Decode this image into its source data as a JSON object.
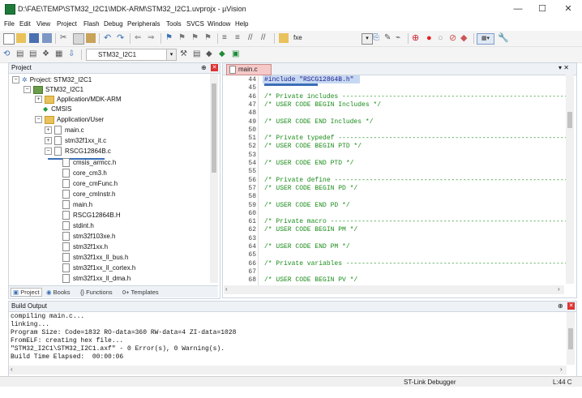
{
  "window": {
    "title": "D:\\FAE\\TEMP\\STM32_I2C1\\MDK-ARM\\STM32_I2C1.uvprojx - µVision",
    "minimize": "—",
    "maximize": "☐",
    "close": "✕"
  },
  "menu": [
    "File",
    "Edit",
    "View",
    "Project",
    "Flash",
    "Debug",
    "Peripherals",
    "Tools",
    "SVCS",
    "Window",
    "Help"
  ],
  "toolbar": {
    "find_text": "fxe",
    "target_name": "STM32_I2C1"
  },
  "project_panel": {
    "title": "Project",
    "pin": "⊕",
    "close": "✕",
    "root": "Project: STM32_I2C1",
    "target": "STM32_I2C1",
    "groups": [
      {
        "name": "Application/MDK-ARM"
      },
      {
        "name": "CMSIS"
      },
      {
        "name": "Application/User"
      }
    ],
    "user_files": [
      "main.c",
      "stm32f1xx_it.c",
      "RSCG12864B.c"
    ],
    "headers": [
      "cmsis_armcc.h",
      "core_cm3.h",
      "core_cmFunc.h",
      "core_cmInstr.h",
      "main.h",
      "RSCG12864B.H",
      "stdint.h",
      "stm32f103xe.h",
      "stm32f1xx.h",
      "stm32f1xx_ll_bus.h",
      "stm32f1xx_ll_cortex.h",
      "stm32f1xx_ll_dma.h"
    ],
    "tabs": [
      "Project",
      "Books",
      "{} Functions",
      "0+ Templates"
    ]
  },
  "editor": {
    "tab": "main.c",
    "close_all": "▾ ✕",
    "lines": [
      {
        "n": "44",
        "text": "#include \"RSCG12864B.h\"",
        "kind": "dir"
      },
      {
        "n": "45",
        "text": "",
        "kind": "cmt"
      },
      {
        "n": "46",
        "text": "/* Private includes ----------------------------------------------------------",
        "kind": "cmt"
      },
      {
        "n": "47",
        "text": "/* USER CODE BEGIN Includes */",
        "kind": "cmt"
      },
      {
        "n": "48",
        "text": "",
        "kind": "cmt"
      },
      {
        "n": "49",
        "text": "/* USER CODE END Includes */",
        "kind": "cmt"
      },
      {
        "n": "50",
        "text": "",
        "kind": "cmt"
      },
      {
        "n": "51",
        "text": "/* Private typedef -----------------------------------------------------------",
        "kind": "cmt"
      },
      {
        "n": "52",
        "text": "/* USER CODE BEGIN PTD */",
        "kind": "cmt"
      },
      {
        "n": "53",
        "text": "",
        "kind": "cmt"
      },
      {
        "n": "54",
        "text": "/* USER CODE END PTD */",
        "kind": "cmt"
      },
      {
        "n": "55",
        "text": "",
        "kind": "cmt"
      },
      {
        "n": "56",
        "text": "/* Private define ------------------------------------------------------------",
        "kind": "cmt"
      },
      {
        "n": "57",
        "text": "/* USER CODE BEGIN PD */",
        "kind": "cmt"
      },
      {
        "n": "58",
        "text": "",
        "kind": "cmt"
      },
      {
        "n": "59",
        "text": "/* USER CODE END PD */",
        "kind": "cmt"
      },
      {
        "n": "60",
        "text": "",
        "kind": "cmt"
      },
      {
        "n": "61",
        "text": "/* Private macro -------------------------------------------------------------",
        "kind": "cmt"
      },
      {
        "n": "62",
        "text": "/* USER CODE BEGIN PM */",
        "kind": "cmt"
      },
      {
        "n": "63",
        "text": "",
        "kind": "cmt"
      },
      {
        "n": "64",
        "text": "/* USER CODE END PM */",
        "kind": "cmt"
      },
      {
        "n": "65",
        "text": "",
        "kind": "cmt"
      },
      {
        "n": "66",
        "text": "/* Private variables ---------------------------------------------------------",
        "kind": "cmt"
      },
      {
        "n": "67",
        "text": "",
        "kind": "cmt"
      },
      {
        "n": "68",
        "text": "/* USER CODE BEGIN PV */",
        "kind": "cmt"
      }
    ]
  },
  "build_output": {
    "title": "Build Output",
    "pin": "⊕",
    "close": "✕",
    "lines": [
      "compiling main.c...",
      "linking...",
      "Program Size: Code=1832 RO-data=360 RW-data=4 ZI-data=1028",
      "FromELF: creating hex file...",
      "\"STM32_I2C1\\STM32_I2C1.axf\" - 0 Error(s), 0 Warning(s).",
      "Build Time Elapsed:  00:00:06"
    ]
  },
  "status": {
    "debugger": "ST-Link Debugger",
    "position": "L:44 C"
  },
  "colors": {
    "accent": "#3b6fb6",
    "comment": "#1a8c1a",
    "directive": "#1c1c8c",
    "tab_active": "#f6c9c9",
    "folder": "#e9c25b"
  }
}
